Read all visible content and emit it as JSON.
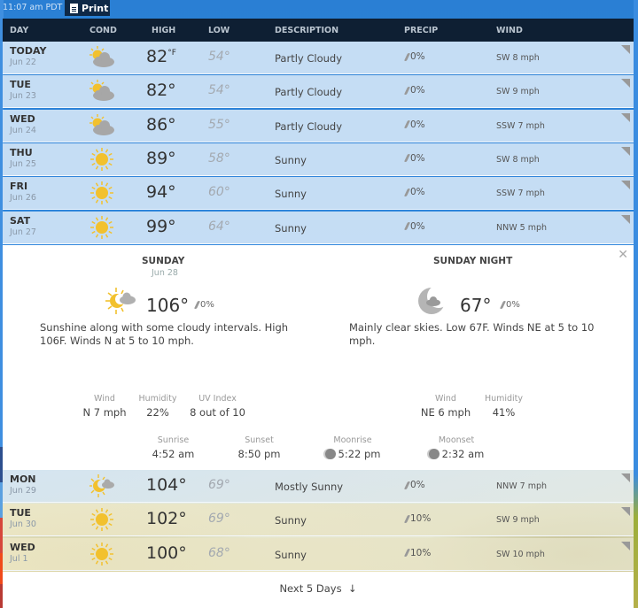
{
  "topbar": {
    "time": "11:07 am PDT",
    "print_label": "Print"
  },
  "table": {
    "headers": [
      "DAY",
      "COND",
      "HIGH",
      "LOW",
      "DESCRIPTION",
      "PRECIP",
      "WIND"
    ],
    "unit": "°F",
    "rows_top": [
      {
        "day": "TODAY",
        "date": "Jun 22",
        "icon": "partly-cloudy-icon",
        "high": "82°",
        "low": "54°",
        "desc": "Partly Cloudy",
        "precip": "0%",
        "wind": "SW 8 mph"
      },
      {
        "day": "TUE",
        "date": "Jun 23",
        "icon": "partly-cloudy-icon",
        "high": "82°",
        "low": "54°",
        "desc": "Partly Cloudy",
        "precip": "0%",
        "wind": "SW 9 mph"
      },
      {
        "day": "WED",
        "date": "Jun 24",
        "icon": "partly-cloudy-icon",
        "high": "86°",
        "low": "55°",
        "desc": "Partly Cloudy",
        "precip": "0%",
        "wind": "SSW 7 mph"
      },
      {
        "day": "THU",
        "date": "Jun 25",
        "icon": "sunny-icon",
        "high": "89°",
        "low": "58°",
        "desc": "Sunny",
        "precip": "0%",
        "wind": "SW 8 mph"
      },
      {
        "day": "FRI",
        "date": "Jun 26",
        "icon": "sunny-icon",
        "high": "94°",
        "low": "60°",
        "desc": "Sunny",
        "precip": "0%",
        "wind": "SSW 7 mph"
      },
      {
        "day": "SAT",
        "date": "Jun 27",
        "icon": "sunny-icon",
        "high": "99°",
        "low": "64°",
        "desc": "Sunny",
        "precip": "0%",
        "wind": "NNW 5 mph"
      }
    ],
    "rows_bottom": [
      {
        "day": "MON",
        "date": "Jun 29",
        "icon": "mostly-sunny-icon",
        "high": "104°",
        "low": "69°",
        "desc": "Mostly Sunny",
        "precip": "0%",
        "wind": "NNW 7 mph"
      },
      {
        "day": "TUE",
        "date": "Jun 30",
        "icon": "sunny-icon",
        "high": "102°",
        "low": "69°",
        "desc": "Sunny",
        "precip": "10%",
        "wind": "SW 9 mph"
      },
      {
        "day": "WED",
        "date": "Jul 1",
        "icon": "sunny-icon",
        "high": "100°",
        "low": "68°",
        "desc": "Sunny",
        "precip": "10%",
        "wind": "SW 10 mph"
      }
    ]
  },
  "detail": {
    "day": {
      "title": "SUNDAY",
      "date": "Jun 28",
      "icon": "mostly-sunny-icon",
      "temp": "106°",
      "precip": "0%",
      "narrative": "Sunshine along with some cloudy intervals. High 106F. Winds N at 5 to 10 mph.",
      "stats": [
        {
          "label": "Wind",
          "value": "N 7 mph"
        },
        {
          "label": "Humidity",
          "value": "22%"
        },
        {
          "label": "UV Index",
          "value": "8 out of 10"
        }
      ]
    },
    "night": {
      "title": "SUNDAY NIGHT",
      "icon": "night-partly-cloudy-icon",
      "temp": "67°",
      "precip": "0%",
      "narrative": "Mainly clear skies. Low 67F. Winds NE at 5 to 10 mph.",
      "stats": [
        {
          "label": "Wind",
          "value": "NE 6 mph"
        },
        {
          "label": "Humidity",
          "value": "41%"
        }
      ]
    },
    "sun_moon": [
      {
        "label": "Sunrise",
        "value": "4:52 am"
      },
      {
        "label": "Sunset",
        "value": "8:50 pm"
      },
      {
        "label": "Moonrise",
        "value": "5:22 pm"
      },
      {
        "label": "Moonset",
        "value": "2:32 am"
      }
    ]
  },
  "footer": {
    "next_label": "Next 5 Days",
    "arrow": "↓"
  },
  "colors": {
    "header_bg": "#0e1f33",
    "row_bg": "#cde1f5",
    "sun": "#f2c12e",
    "cloud": "#a7a7a7",
    "page_blue": "#2f86dc"
  }
}
